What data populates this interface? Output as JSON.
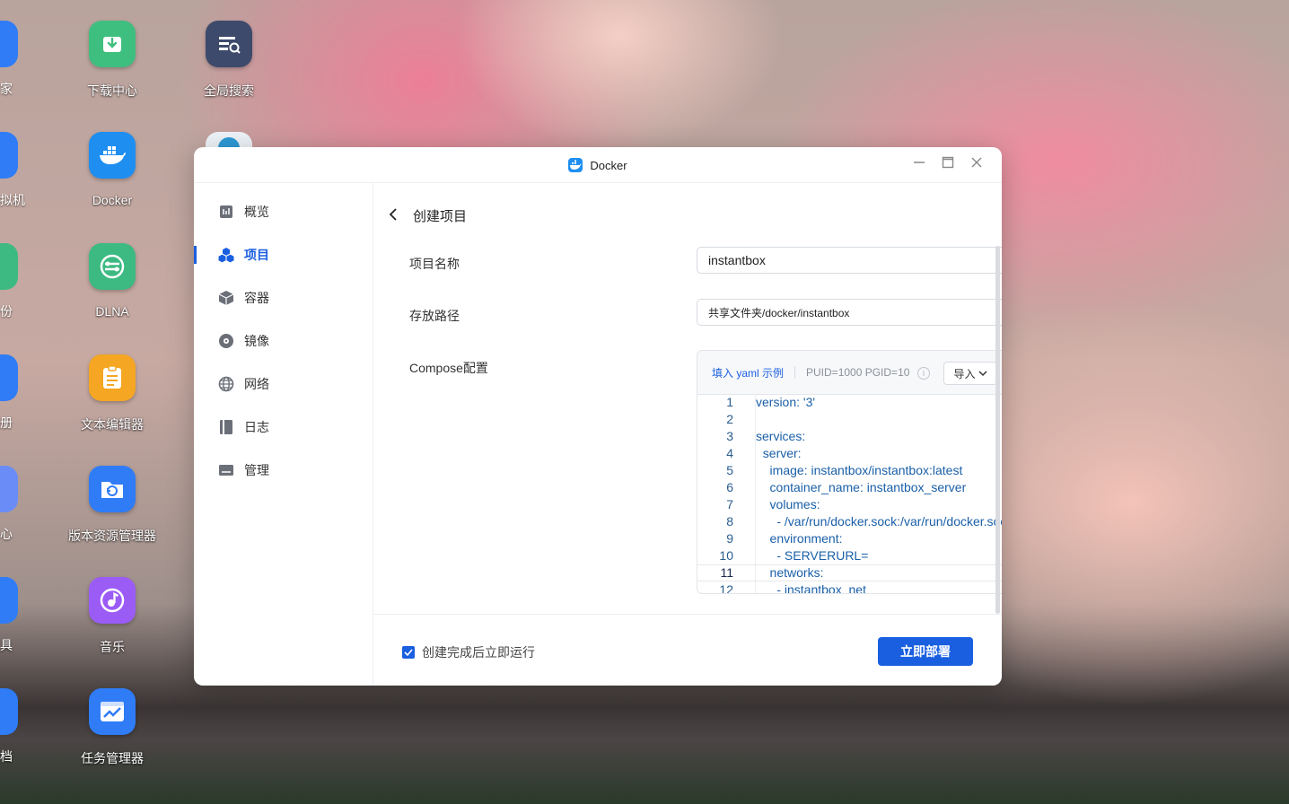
{
  "desktop": {
    "icons": [
      {
        "label": "下载中心",
        "color": "#3fbf7f"
      },
      {
        "label": "全局搜索",
        "color": "#3d4a6b"
      },
      {
        "label": "Docker",
        "color": "#1f8ef1"
      },
      {
        "label": "DLNA",
        "color": "#3dba82"
      },
      {
        "label": "文本编辑器",
        "color": "#f5a623"
      },
      {
        "label": "版本资源管理器",
        "color": "#2f7cf6"
      },
      {
        "label": "音乐",
        "color": "#9b5cf6"
      },
      {
        "label": "任务管理器",
        "color": "#2f7cf6"
      }
    ],
    "cut_labels": [
      "管家",
      "虚拟机",
      "备份",
      "相册",
      "中心",
      "工具",
      "文档"
    ]
  },
  "window": {
    "title": "Docker",
    "minimize_icon": "minimize-icon",
    "maximize_icon": "maximize-icon",
    "close_icon": "close-icon"
  },
  "sidebar": {
    "items": [
      {
        "label": "概览",
        "icon": "overview-icon"
      },
      {
        "label": "项目",
        "icon": "project-icon",
        "active": true
      },
      {
        "label": "容器",
        "icon": "container-icon"
      },
      {
        "label": "镜像",
        "icon": "image-icon"
      },
      {
        "label": "网络",
        "icon": "network-icon"
      },
      {
        "label": "日志",
        "icon": "log-icon"
      },
      {
        "label": "管理",
        "icon": "manage-icon"
      }
    ]
  },
  "page": {
    "title": "创建项目",
    "project_name_label": "项目名称",
    "project_name_value": "instantbox",
    "path_label": "存放路径",
    "path_value": "共享文件夹/docker/instantbox",
    "compose_label": "Compose配置",
    "fill_example": "填入 yaml 示例",
    "puid_hint": "PUID=1000 PGID=10",
    "import_label": "导入",
    "code_lines": [
      {
        "n": "1",
        "text": "version: '3'"
      },
      {
        "n": "2",
        "text": ""
      },
      {
        "n": "3",
        "text": "services:"
      },
      {
        "n": "4",
        "text": "  server:"
      },
      {
        "n": "5",
        "text": "    image: instantbox/instantbox:latest"
      },
      {
        "n": "6",
        "text": "    container_name: instantbox_server"
      },
      {
        "n": "7",
        "text": "    volumes:"
      },
      {
        "n": "8",
        "text": "      - /var/run/docker.sock:/var/run/docker.sock"
      },
      {
        "n": "9",
        "text": "    environment:"
      },
      {
        "n": "10",
        "text": "      - SERVERURL="
      },
      {
        "n": "11",
        "text": "    networks:"
      },
      {
        "n": "12",
        "text": "      - instantbox_net"
      }
    ],
    "current_line": "11",
    "run_after_create": "创建完成后立即运行",
    "deploy_button": "立即部署"
  },
  "colors": {
    "accent": "#1a5fe0"
  }
}
